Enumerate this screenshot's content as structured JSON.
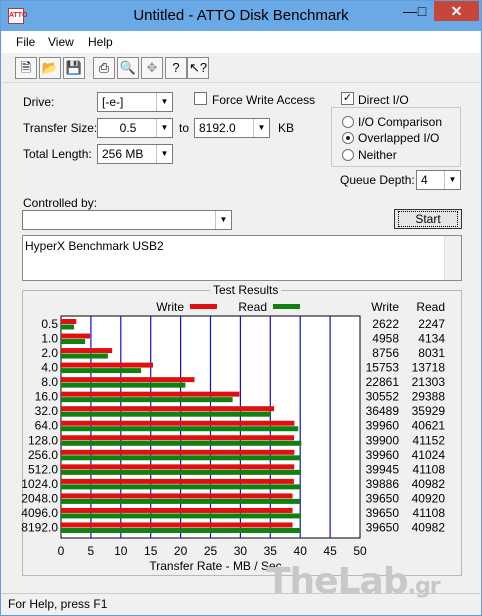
{
  "window": {
    "title": "Untitled - ATTO Disk Benchmark",
    "icon_text": "ATTO"
  },
  "menu": [
    "File",
    "View",
    "Help"
  ],
  "toolbar": [
    "new-icon",
    "open-icon",
    "save-icon",
    "print-icon",
    "print-preview-icon",
    "move-icon",
    "help-icon",
    "context-help-icon"
  ],
  "form": {
    "drive_label": "Drive:",
    "drive_value": "[-e-]",
    "force_write_label": "Force Write Access",
    "force_write_checked": false,
    "direct_io_label": "Direct I/O",
    "direct_io_checked": true,
    "transfer_size_label": "Transfer Size:",
    "transfer_from": "0.5",
    "to_label": "to",
    "transfer_to": "8192.0",
    "kb_label": "KB",
    "total_length_label": "Total Length:",
    "total_length": "256 MB",
    "io_comparison": "I/O Comparison",
    "overlapped_io": "Overlapped I/O",
    "neither": "Neither",
    "queue_depth_label": "Queue Depth:",
    "queue_depth": "4",
    "controlled_by_label": "Controlled by:",
    "controlled_by_value": "",
    "start_label": "Start",
    "description": "HyperX Benchmark USB2"
  },
  "results": {
    "title": "Test Results",
    "write_label": "Write",
    "read_label": "Read",
    "write_col": "Write",
    "read_col": "Read"
  },
  "chart_data": {
    "type": "bar",
    "orientation": "horizontal",
    "categories": [
      "0.5",
      "1.0",
      "2.0",
      "4.0",
      "8.0",
      "16.0",
      "32.0",
      "64.0",
      "128.0",
      "256.0",
      "512.0",
      "1024.0",
      "2048.0",
      "4096.0",
      "8192.0"
    ],
    "series": [
      {
        "name": "Write",
        "color": "#e01010",
        "values": [
          2622,
          4958,
          8756,
          15753,
          22861,
          30552,
          36489,
          39960,
          39900,
          39960,
          39945,
          39886,
          39650,
          39650,
          39650
        ]
      },
      {
        "name": "Read",
        "color": "#108010",
        "values": [
          2247,
          4134,
          8031,
          13718,
          21303,
          29388,
          35929,
          40621,
          41152,
          41024,
          41108,
          40982,
          40920,
          41108,
          40982
        ]
      }
    ],
    "xlabel": "Transfer Rate - MB / Sec",
    "xticks": [
      "0",
      "5",
      "10",
      "15",
      "20",
      "25",
      "30",
      "35",
      "40",
      "45",
      "50"
    ],
    "xlim": [
      0,
      50
    ],
    "grid": true,
    "legend": "top"
  },
  "status": {
    "text": "For Help, press F1"
  },
  "watermark": {
    "main": "TheLab",
    "suffix": ".gr"
  }
}
